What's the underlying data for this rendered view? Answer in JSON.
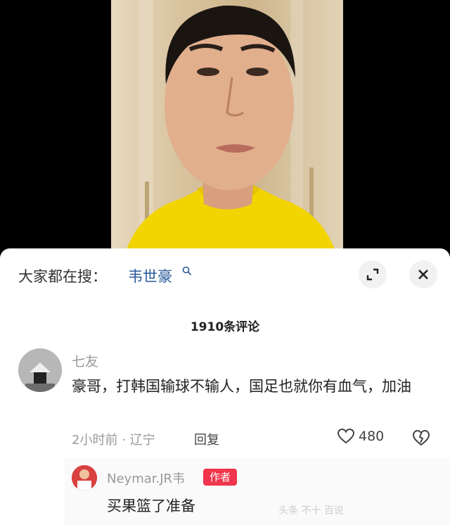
{
  "video": {
    "description_icon": "video-frame"
  },
  "search": {
    "prefix": "大家都在搜：",
    "term": "韦世豪",
    "term_icon": "search-icon"
  },
  "header_buttons": {
    "expand_icon": "expand-icon",
    "close_icon": "close-icon"
  },
  "comments_header": {
    "count_label": "1910条评论"
  },
  "comment": {
    "username": "七友",
    "text": "豪哥，打韩国输球不输人，国足也就你有血气，加油",
    "meta": "2小时前 · 辽宁",
    "reply_label": "回复",
    "likes": "480"
  },
  "reply": {
    "username": "Neymar.JR韦",
    "badge": "作者",
    "text": "买果篮了准备"
  },
  "watermark": "头条 不十 百说",
  "colors": {
    "search_term": "#2a5a9c",
    "author_badge": "#f0354c"
  }
}
